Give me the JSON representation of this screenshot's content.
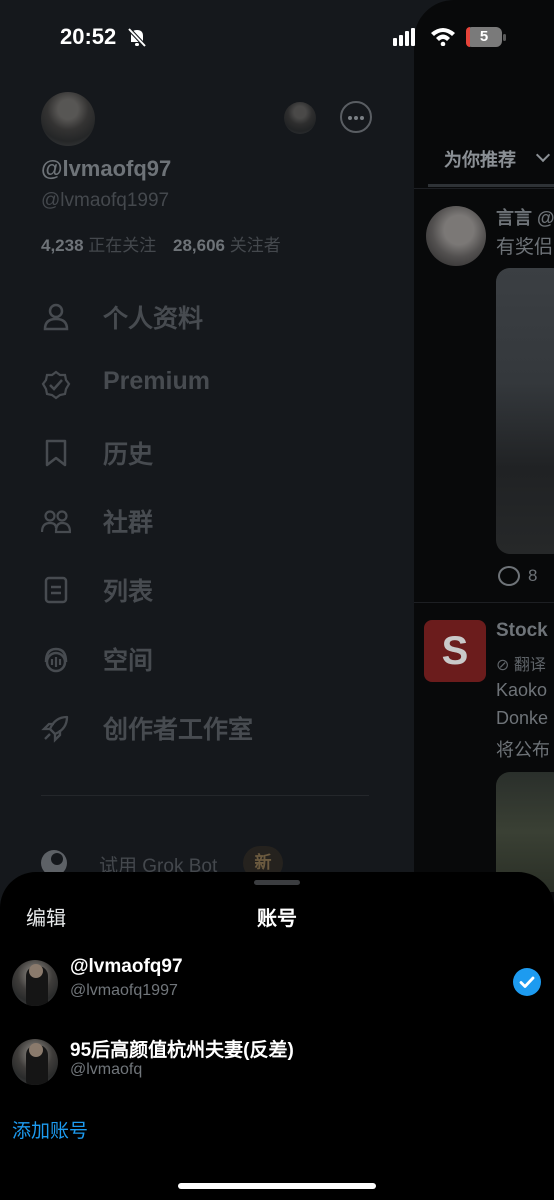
{
  "status_bar": {
    "time": "20:52",
    "battery": "5"
  },
  "drawer": {
    "handle": "@lvmaofq97",
    "sub_handle": "@lvmaofq1997",
    "following_count": "4,238",
    "following_label": "正在关注",
    "followers_count": "28,606",
    "followers_label": "关注者",
    "menu": [
      {
        "label": "个人资料",
        "icon": "person-icon"
      },
      {
        "label": "Premium",
        "icon": "verified-badge-icon"
      },
      {
        "label": "历史",
        "icon": "bookmark-icon"
      },
      {
        "label": "社群",
        "icon": "communities-icon"
      },
      {
        "label": "列表",
        "icon": "list-icon"
      },
      {
        "label": "空间",
        "icon": "spaces-icon"
      },
      {
        "label": "创作者工作室",
        "icon": "rocket-icon"
      }
    ],
    "grok_label": "试用 Grok Bot",
    "grok_badge": "新"
  },
  "timeline": {
    "tab": "为你推荐",
    "post1_name": "言言 @",
    "post1_text": "有奖侣",
    "post1_replies": "8",
    "post2_logo": "S",
    "post2_name": "Stock",
    "post2_translate": "翻译",
    "post2_lines": [
      "Kaoko",
      "Donke",
      "将公布"
    ]
  },
  "sheet": {
    "edit_label": "编辑",
    "title": "账号",
    "accounts": [
      {
        "name": "@lvmaofq97",
        "handle": "@lvmaofq1997",
        "selected": true
      },
      {
        "name": "95后高颜值杭州夫妻(反差)",
        "handle": "@lvmaofq",
        "selected": false
      }
    ],
    "add_account": "添加账号"
  },
  "colors": {
    "accent": "#1d9bf0",
    "sheet_bg": "#000000",
    "drawer_bg": "#15181c"
  }
}
